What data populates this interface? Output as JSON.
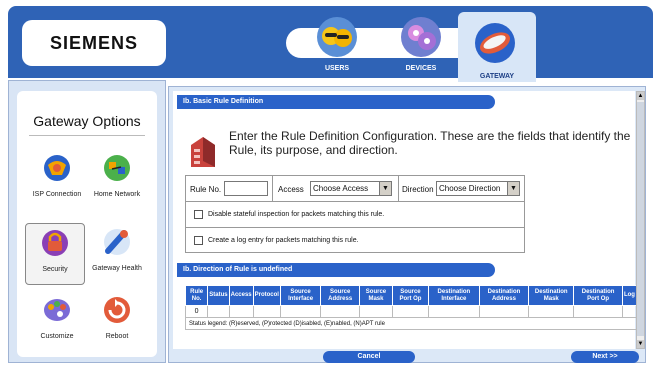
{
  "header": {
    "brand": "SIEMENS",
    "nav": [
      {
        "label": "USERS"
      },
      {
        "label": "DEVICES"
      },
      {
        "label": "GATEWAY"
      }
    ]
  },
  "sidebar": {
    "title": "Gateway Options",
    "options": [
      {
        "label": "ISP Connection"
      },
      {
        "label": "Home Network"
      },
      {
        "label": "Security"
      },
      {
        "label": "Gateway Health"
      },
      {
        "label": "Customize"
      },
      {
        "label": "Reboot"
      }
    ]
  },
  "main": {
    "basic_section_title": "Ib. Basic Rule Definition",
    "intro_text": "Enter the Rule Definition Configuration. These are the fields that identify the Rule, its purpose, and direction.",
    "rule_no_label": "Rule No.",
    "rule_no_value": "",
    "access_label": "Access",
    "access_selected": "Choose Access",
    "direction_label": "Direction",
    "direction_selected": "Choose Direction",
    "checkbox1_label": "Disable stateful inspection for packets matching this rule.",
    "checkbox2_label": "Create a log entry for packets matching this rule.",
    "direction_section_title": "Ib. Direction of Rule is undefined",
    "table": {
      "headers": [
        "Rule No.",
        "Status",
        "Access",
        "Protocol",
        "Source Interface",
        "Source Address",
        "Source Mask",
        "Source Port Op",
        "Destination Interface",
        "Destination Address",
        "Destination Mask",
        "Destination Port Op",
        "Log"
      ],
      "row": [
        "0",
        "",
        "",
        "",
        "",
        "",
        "",
        "",
        "",
        "",
        "",
        "",
        ""
      ],
      "legend": "Status legend: (R)eserved, (P)rotected (D)isabled, (E)nabled, (N)APT rule"
    },
    "cancel_label": "Cancel",
    "next_label": "Next >>"
  },
  "colors": {
    "header_blue": "#2f63b6",
    "section_blue": "#2a62c9",
    "panel_light": "#dce8f7"
  }
}
